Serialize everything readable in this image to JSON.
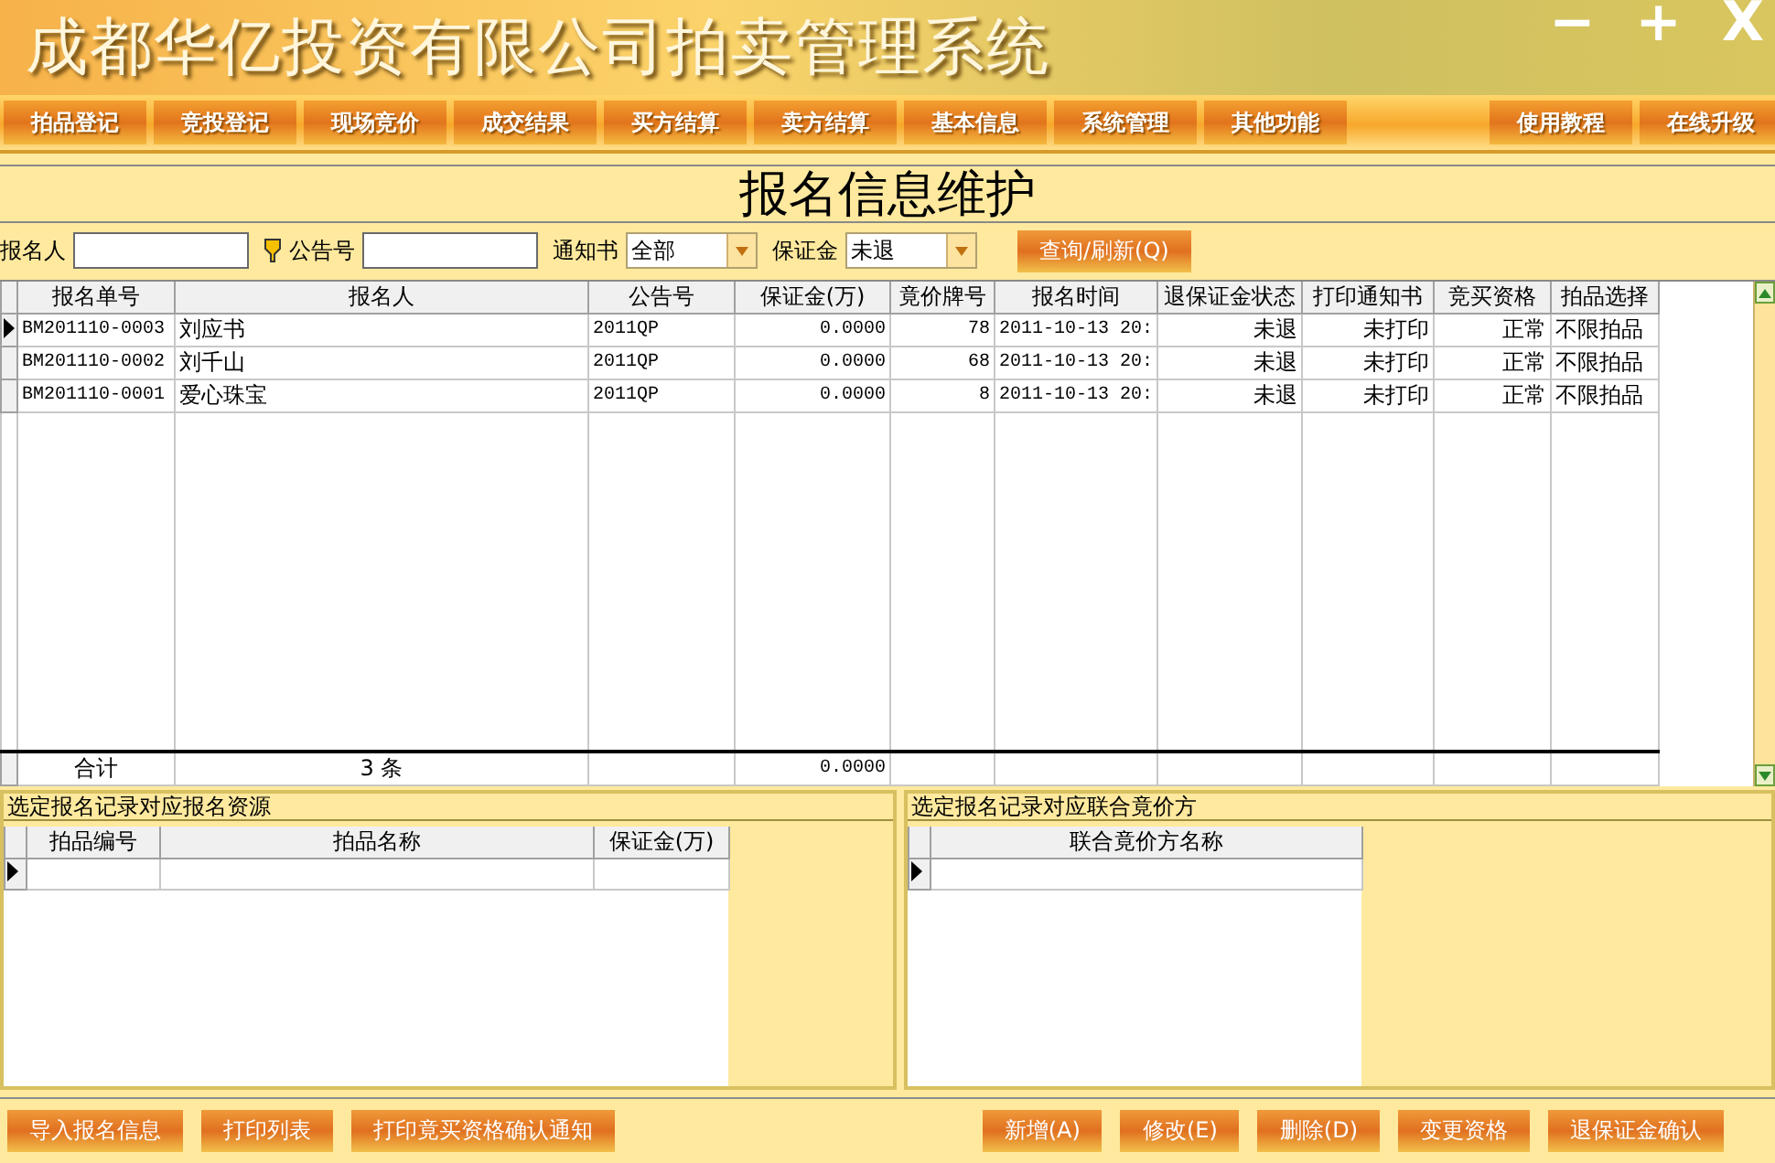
{
  "app_title": "成都华亿投资有限公司拍卖管理系统",
  "window_controls": [
    "−",
    "+",
    "X"
  ],
  "menu_left": [
    "拍品登记",
    "竞投登记",
    "现场竞价",
    "成交结果",
    "买方结算",
    "卖方结算",
    "基本信息",
    "系统管理",
    "其他功能"
  ],
  "menu_right": [
    "使用教程",
    "在线升级"
  ],
  "page_title": "报名信息维护",
  "filters": [
    {
      "kind": "text",
      "label": "报名人"
    },
    {
      "kind": "text",
      "label": "公告号",
      "icon": true
    },
    {
      "kind": "select",
      "label": "通知书",
      "value": "全部"
    },
    {
      "kind": "select",
      "label": "保证金",
      "value": "未退"
    }
  ],
  "query_button": "查询/刷新(Q)",
  "table": {
    "columns": [
      "报名单号",
      "报名人",
      "公告号",
      "保证金(万)",
      "竟价牌号",
      "报名时间",
      "退保证金状态",
      "打印通知书",
      "竞买资格",
      "拍品选择"
    ],
    "rows": [
      {
        "selected": true,
        "cells": [
          "BM201110-0003",
          "刘应书",
          "2011QP",
          "0.0000",
          "78",
          "2011-10-13 20:",
          "未退",
          "未打印",
          "正常",
          "不限拍品"
        ]
      },
      {
        "selected": false,
        "cells": [
          "BM201110-0002",
          "刘千山",
          "2011QP",
          "0.0000",
          "68",
          "2011-10-13 20:",
          "未退",
          "未打印",
          "正常",
          "不限拍品"
        ]
      },
      {
        "selected": false,
        "cells": [
          "BM201110-0001",
          "爱心珠宝",
          "2011QP",
          "0.0000",
          "8",
          "2011-10-13 20:",
          "未退",
          "未打印",
          "正常",
          "不限拍品"
        ]
      }
    ],
    "footer": {
      "label": "合计",
      "count": "3 条",
      "deposit_total": "0.0000"
    }
  },
  "resources_panel": {
    "title": "选定报名记录对应报名资源",
    "columns": [
      "拍品编号",
      "拍品名称",
      "保证金(万)"
    ]
  },
  "partners_panel": {
    "title": "选定报名记录对应联合竟价方",
    "columns": [
      "联合竟价方名称"
    ]
  },
  "bottom_left_buttons": [
    "导入报名信息",
    "打印列表",
    "打印竟买资格确认通知"
  ],
  "bottom_right_buttons": [
    "新增(A)",
    "修改(E)",
    "删除(D)",
    "变更资格",
    "退保证金确认"
  ]
}
